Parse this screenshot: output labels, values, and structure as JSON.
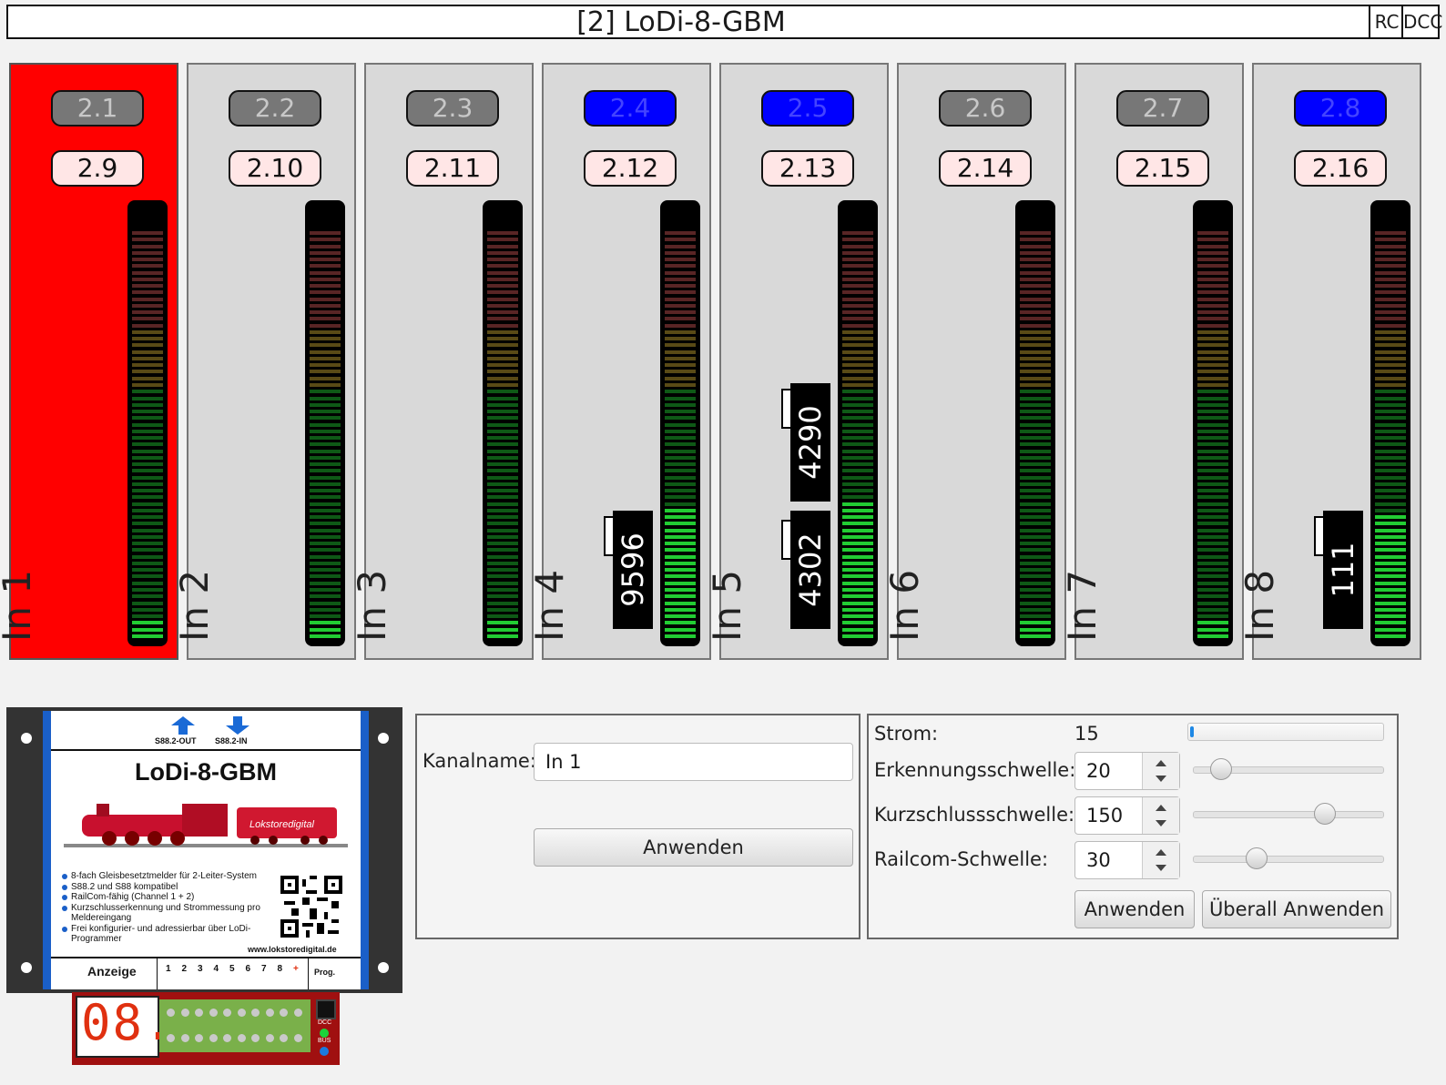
{
  "window": {
    "title": "[2] LoDi-8-GBM",
    "btn_rc": "RC",
    "btn_dcc": "DCC"
  },
  "colors": {
    "active_channel": "#ff0000",
    "address_active": "#0000ff",
    "address_inactive": "#777777",
    "meter_green": "#22cc33",
    "meter_yellow": "#ccaa33",
    "meter_red": "#cc5555"
  },
  "channels": [
    {
      "label": "In 1",
      "addr_top": "2.1",
      "addr_bottom": "2.9",
      "active": true,
      "addr_top_active": false,
      "level": 0.05,
      "locos": []
    },
    {
      "label": "In 2",
      "addr_top": "2.2",
      "addr_bottom": "2.10",
      "active": false,
      "addr_top_active": false,
      "level": 0.05,
      "locos": []
    },
    {
      "label": "In 3",
      "addr_top": "2.3",
      "addr_bottom": "2.11",
      "active": false,
      "addr_top_active": false,
      "level": 0.05,
      "locos": []
    },
    {
      "label": "In 4",
      "addr_top": "2.4",
      "addr_bottom": "2.12",
      "active": false,
      "addr_top_active": true,
      "level": 0.32,
      "locos": [
        "9596"
      ]
    },
    {
      "label": "In 5",
      "addr_top": "2.5",
      "addr_bottom": "2.13",
      "active": false,
      "addr_top_active": true,
      "level": 0.34,
      "locos": [
        "4302",
        "4290"
      ]
    },
    {
      "label": "In 6",
      "addr_top": "2.6",
      "addr_bottom": "2.14",
      "active": false,
      "addr_top_active": false,
      "level": 0.05,
      "locos": []
    },
    {
      "label": "In 7",
      "addr_top": "2.7",
      "addr_bottom": "2.15",
      "active": false,
      "addr_top_active": false,
      "level": 0.05,
      "locos": []
    },
    {
      "label": "In 8",
      "addr_top": "2.8",
      "addr_bottom": "2.16",
      "active": false,
      "addr_top_active": true,
      "level": 0.31,
      "locos": [
        "111"
      ]
    }
  ],
  "channel_panel": {
    "name_label": "Kanalname:",
    "name_value": "In 1",
    "apply": "Anwenden"
  },
  "settings": {
    "strom_label": "Strom:",
    "strom_value": "15",
    "strom_level": 0.02,
    "erkennung_label": "Erkennungsschwelle:",
    "erkennung_value": "20",
    "erkennung_level": 0.1,
    "kurzschluss_label": "Kurzschlussschwelle:",
    "kurzschluss_value": "150",
    "kurzschluss_level": 0.72,
    "railcom_label": "Railcom-Schwelle:",
    "railcom_value": "30",
    "railcom_level": 0.31,
    "apply": "Anwenden",
    "apply_all": "Überall Anwenden"
  },
  "device": {
    "out_label": "S88.2-OUT",
    "in_label": "S88.2-IN",
    "name": "LoDi-8-GBM",
    "loco_brand": "Lokstoredigital",
    "features": [
      "8-fach Gleisbesetztmelder für 2-Leiter-System",
      "S88.2 und S88 kompatibel",
      "RailCom-fähig (Channel 1 + 2)",
      "Kurzschlusserkennung und Strommessung pro Meldereingang",
      "Frei konfigurier- und adressierbar über LoDi-Programmer"
    ],
    "url": "www.lokstoredigital.de",
    "display_label": "Anzeige",
    "numbers": [
      "1",
      "2",
      "3",
      "4",
      "5",
      "6",
      "7",
      "8",
      "+"
    ],
    "prog_label": "Prog.",
    "display_value": "08.",
    "dcc_label": "DCC",
    "bus_label": "BUS"
  }
}
